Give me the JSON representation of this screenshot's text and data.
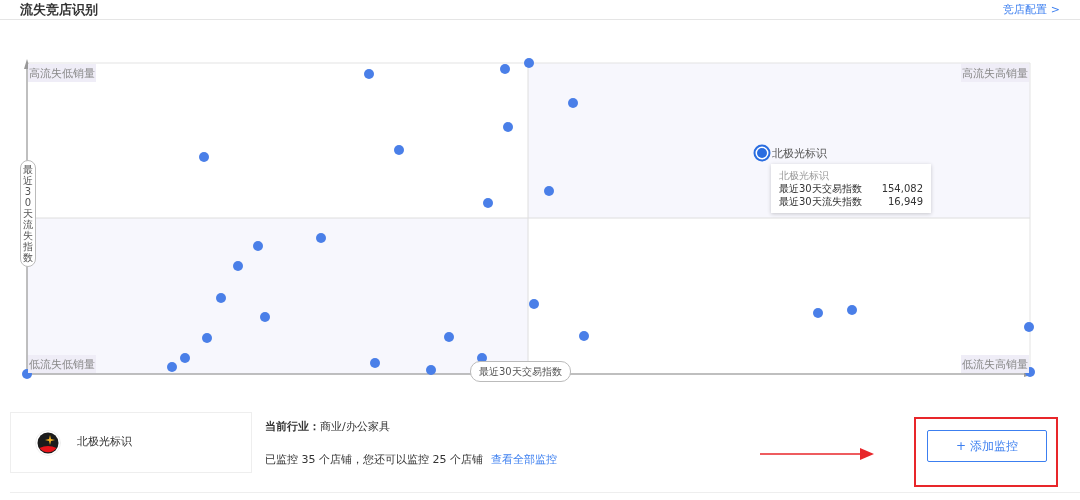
{
  "header": {
    "title": "流失竞店识别",
    "link": "竞店配置 >"
  },
  "chart": {
    "quadrant_labels": [
      "高流失低销量",
      "高流失高销量",
      "低流失低销量",
      "低流失高销量"
    ],
    "y_axis_label": "最近30天流失指数",
    "x_axis_label": "最近30天交易指数",
    "highlight": {
      "label": "北极光标识",
      "tooltip": {
        "title": "北极光标识",
        "rows": [
          {
            "label": "最近30天交易指数",
            "value": "154,082"
          },
          {
            "label": "最近30天流失指数",
            "value": "16,949"
          }
        ]
      }
    }
  },
  "shop": {
    "name": "北极光标识"
  },
  "info": {
    "industry": "**当前行业：**商业/办公家具",
    "monitor_text": "已监控 35 个店铺，您还可以监控 25 个店铺",
    "link": "查看全部监控"
  },
  "add_button": "+ 添加监控"
}
